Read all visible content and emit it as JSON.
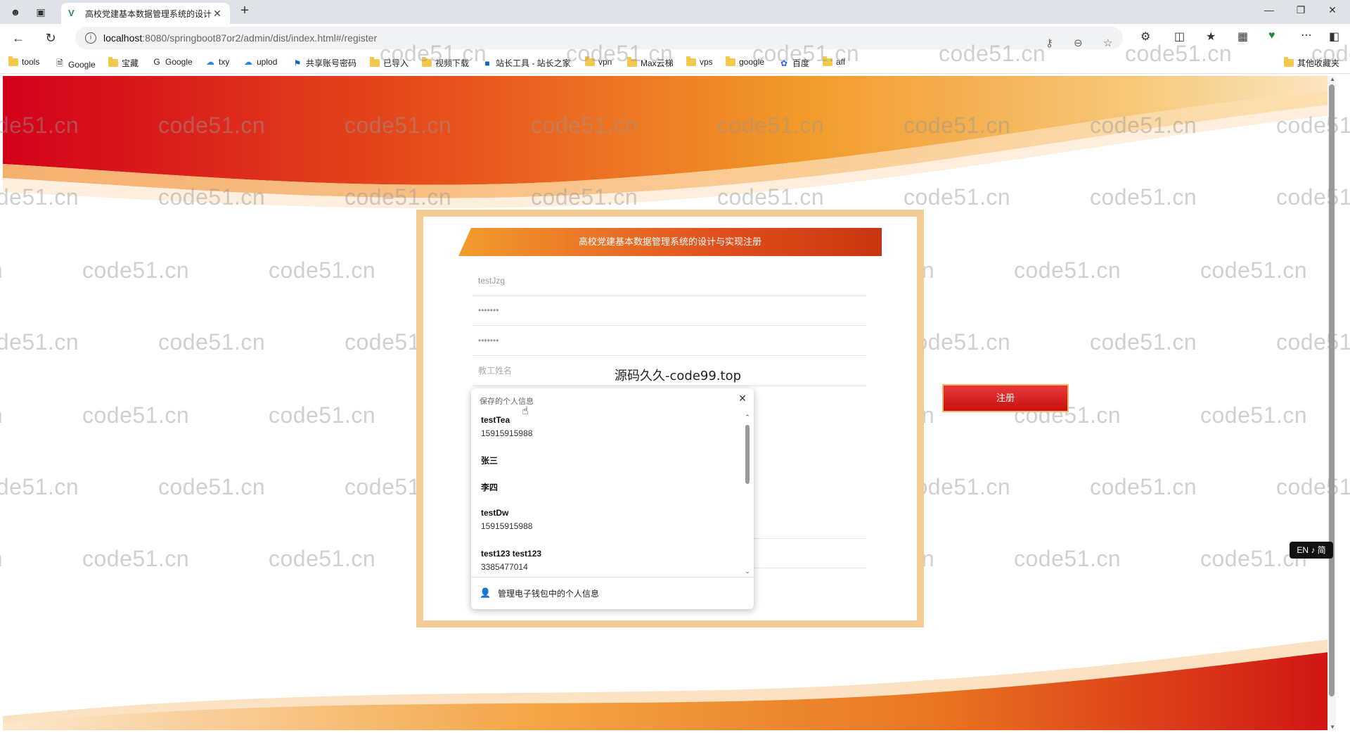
{
  "browser": {
    "tab_title": "高校党建基本数据管理系统的设计",
    "address": {
      "host": "localhost",
      "path": ":8080/springboot87or2/admin/dist/index.html#/register"
    },
    "bookmarks": [
      "tools",
      "Google",
      "宝藏",
      "Google",
      "txy",
      "uplod",
      "共享账号密码",
      "已导入",
      "视频下载",
      "站长工具 - 站长之家",
      "vpn",
      "Max云梯",
      "vps",
      "google",
      "百度",
      "aff"
    ],
    "other_bookmarks": "其他收藏夹"
  },
  "watermark_text": "code51.cn",
  "form": {
    "title": "高校党建基本数据管理系统的设计与实现注册",
    "username_value": "testJzg",
    "password_value": "•••••••",
    "confirm_value": "•••••••",
    "name_placeholder": "教工姓名",
    "overlay_text": "源码久久-code99.top",
    "register_label": "注册"
  },
  "autofill": {
    "header": "保存的个人信息",
    "items": [
      {
        "name": "testTea",
        "phone": "15915915988"
      },
      {
        "name": "张三",
        "phone": ""
      },
      {
        "name": "李四",
        "phone": ""
      },
      {
        "name": "testDw",
        "phone": "15915915988"
      },
      {
        "name": "test123 test123",
        "phone": "3385477014"
      }
    ],
    "footer": "管理电子钱包中的个人信息"
  },
  "ime_indicator": "EN ♪ 简",
  "colors": {
    "title_bar": "#e0521e",
    "button": "#d41f1f",
    "frame": "#f3cc95"
  }
}
